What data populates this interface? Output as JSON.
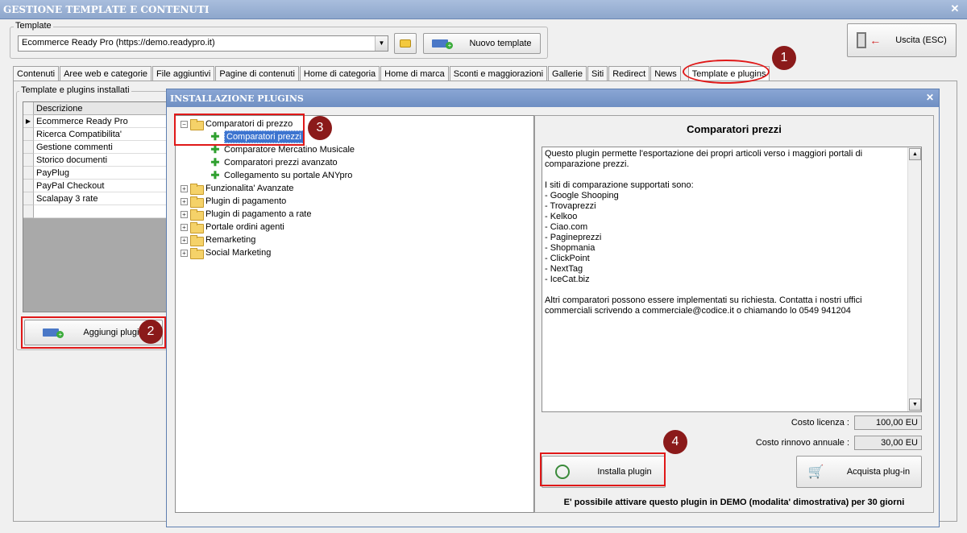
{
  "window": {
    "title": "GESTIONE TEMPLATE E CONTENUTI",
    "close": "✕"
  },
  "template_group": {
    "label": "Template",
    "selected": "Ecommerce Ready Pro (https://demo.readypro.it)",
    "new_button": "Nuovo template"
  },
  "exit_button": "Uscita (ESC)",
  "tabs": [
    "Contenuti",
    "Aree web e categorie",
    "File aggiuntivi",
    "Pagine di contenuti",
    "Home di categoria",
    "Home di marca",
    "Sconti e maggiorazioni",
    "Gallerie",
    "Siti",
    "Redirect",
    "News",
    "Template e plugins"
  ],
  "installed": {
    "label": "Template e plugins installati",
    "header": "Descrizione",
    "rows": [
      "Ecommerce Ready Pro",
      "Ricerca Compatibilita'",
      "Gestione commenti",
      "Storico documenti",
      "PayPlug",
      "PayPal Checkout",
      "Scalapay 3 rate"
    ],
    "add_button": "Aggiungi plugin"
  },
  "dialog": {
    "title": "INSTALLAZIONE PLUGINS",
    "close": "✕",
    "tree": [
      {
        "label": "Comparatori di prezzo",
        "children": [
          "Comparatori prezzi",
          "Comparatore Mercatino Musicale",
          "Comparatori prezzi avanzato",
          "Collegamento su portale ANYpro"
        ]
      },
      {
        "label": "Funzionalita' Avanzate"
      },
      {
        "label": "Plugin di pagamento"
      },
      {
        "label": "Plugin di pagamento a rate"
      },
      {
        "label": "Portale ordini agenti"
      },
      {
        "label": "Remarketing"
      },
      {
        "label": "Social Marketing"
      }
    ],
    "detail_title": "Comparatori prezzi",
    "description": "Questo plugin permette l'esportazione dei propri articoli verso i maggiori portali di comparazione prezzi.\n\nI siti di comparazione supportati sono:\n- Google Shooping\n- Trovaprezzi\n- Kelkoo\n- Ciao.com\n- Pagineprezzi\n- Shopmania\n- ClickPoint\n- NextTag\n- IceCat.biz\n\nAltri comparatori possono essere implementati su richiesta. Contatta i nostri uffici commerciali scrivendo a commerciale@codice.it o chiamando lo 0549 941204",
    "license_label": "Costo licenza :",
    "license_value": "100,00 EU",
    "renewal_label": "Costo rinnovo annuale :",
    "renewal_value": "30,00 EU",
    "install_button": "Installa plugin",
    "buy_button": "Acquista plug-in",
    "demo_note": "E' possibile attivare questo plugin in DEMO (modalita' dimostrativa) per 30 giorni"
  },
  "annotations": [
    "1",
    "2",
    "3",
    "4"
  ],
  "colors": {
    "highlight": "#e01818",
    "badge": "#8b1a1a",
    "title_bar": "#8ea7cc",
    "selection": "#3c74d0"
  }
}
